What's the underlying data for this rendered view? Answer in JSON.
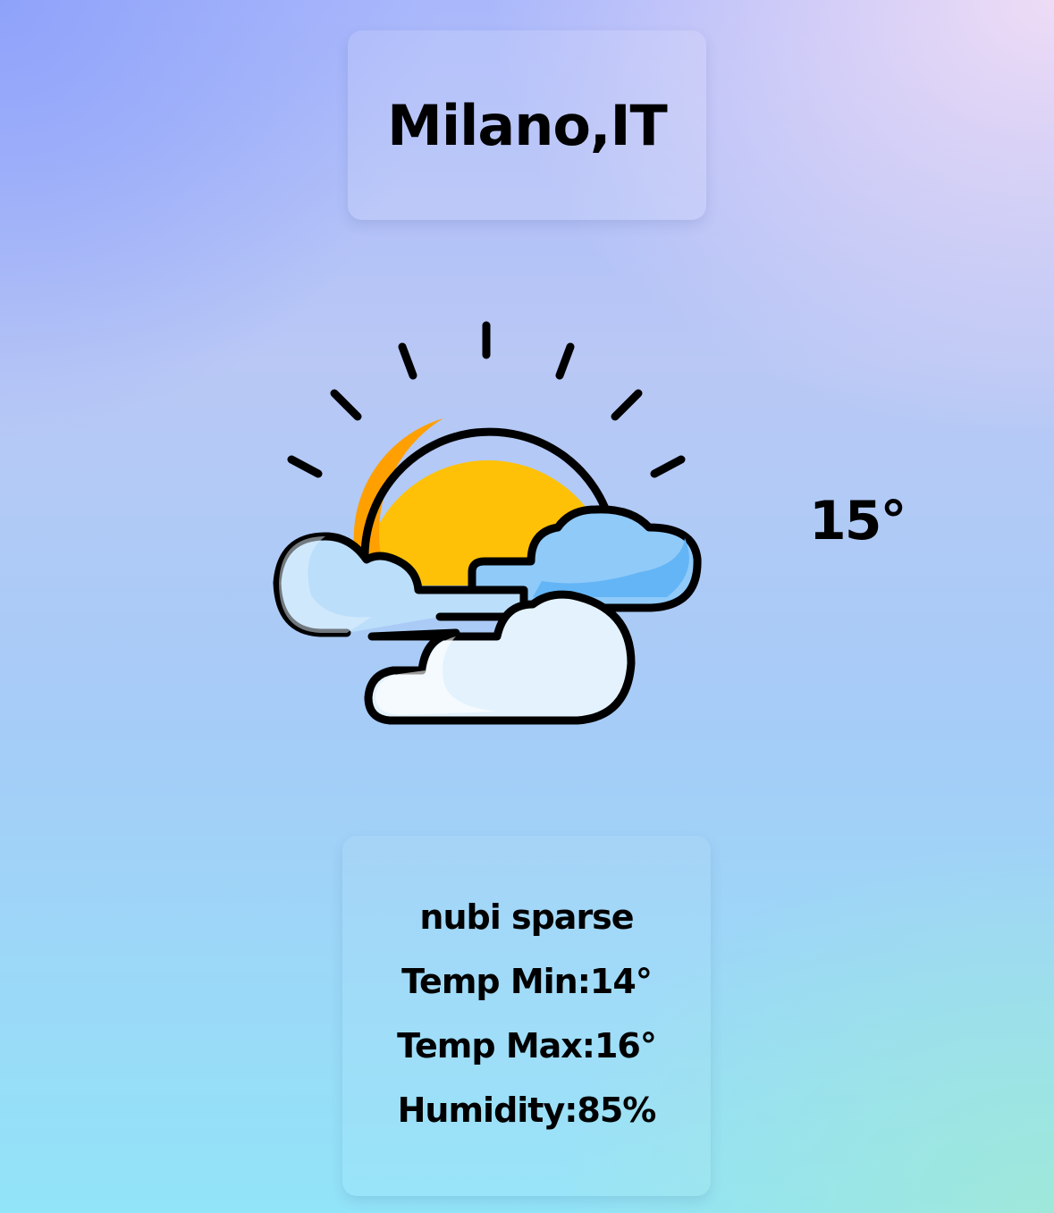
{
  "location": {
    "city": "Milano,IT"
  },
  "current": {
    "temperature": "15°",
    "icon": "sun-behind-clouds-icon"
  },
  "details": {
    "description": "nubi sparse",
    "temp_min": "Temp Min:14°",
    "temp_max": "Temp Max:16°",
    "humidity": "Humidity:85%"
  },
  "colors": {
    "sun": "#FFC107",
    "sun_shade": "#FFA000",
    "cloud_blue": "#90CAF9",
    "cloud_light": "#E3F2FD",
    "outline": "#000000"
  }
}
